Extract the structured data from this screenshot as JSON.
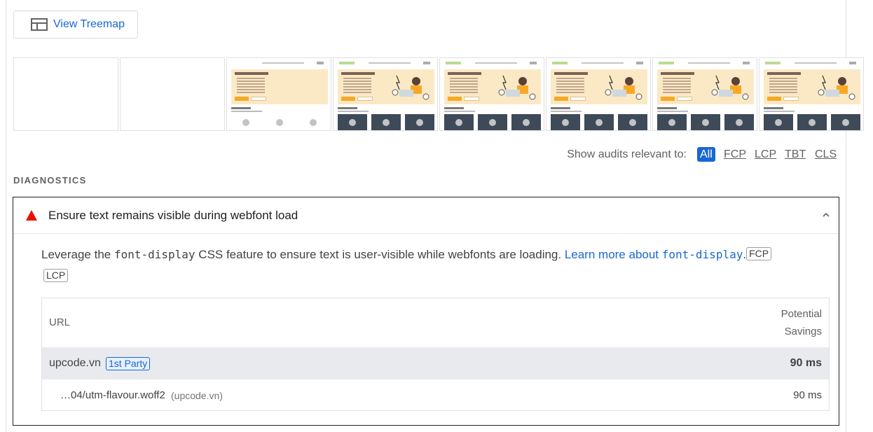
{
  "toolbar": {
    "treemap_label": "View Treemap",
    "treemap_icon": "treemap-icon"
  },
  "filmstrip": {
    "frames": [
      "blank",
      "blank",
      "partial",
      "full",
      "full",
      "full",
      "full",
      "full"
    ]
  },
  "filter": {
    "label": "Show audits relevant to:",
    "options": [
      "All",
      "FCP",
      "LCP",
      "TBT",
      "CLS"
    ],
    "active": "All",
    "accent": "#1967d2"
  },
  "diagnostics": {
    "heading": "DIAGNOSTICS"
  },
  "audit": {
    "status_icon": "warning-triangle-icon",
    "status_color": "#eb0f00",
    "title": "Ensure text remains visible during webfont load",
    "expanded": true,
    "description": {
      "pre": "Leverage the ",
      "code1": "font-display",
      "mid": " CSS feature to ensure text is user-visible while webfonts are loading. ",
      "link_text": "Learn more about ",
      "link_code": "font-display",
      "post": ".",
      "tags": [
        "FCP",
        "LCP"
      ]
    },
    "table": {
      "col_url": "URL",
      "col_savings_1": "Potential",
      "col_savings_2": "Savings",
      "group": {
        "host": "upcode.vn",
        "badge": "1st Party",
        "value": "90 ms"
      },
      "item": {
        "file": "…04/utm-flavour.woff2",
        "origin": "(upcode.vn)",
        "value": "90 ms"
      }
    }
  }
}
